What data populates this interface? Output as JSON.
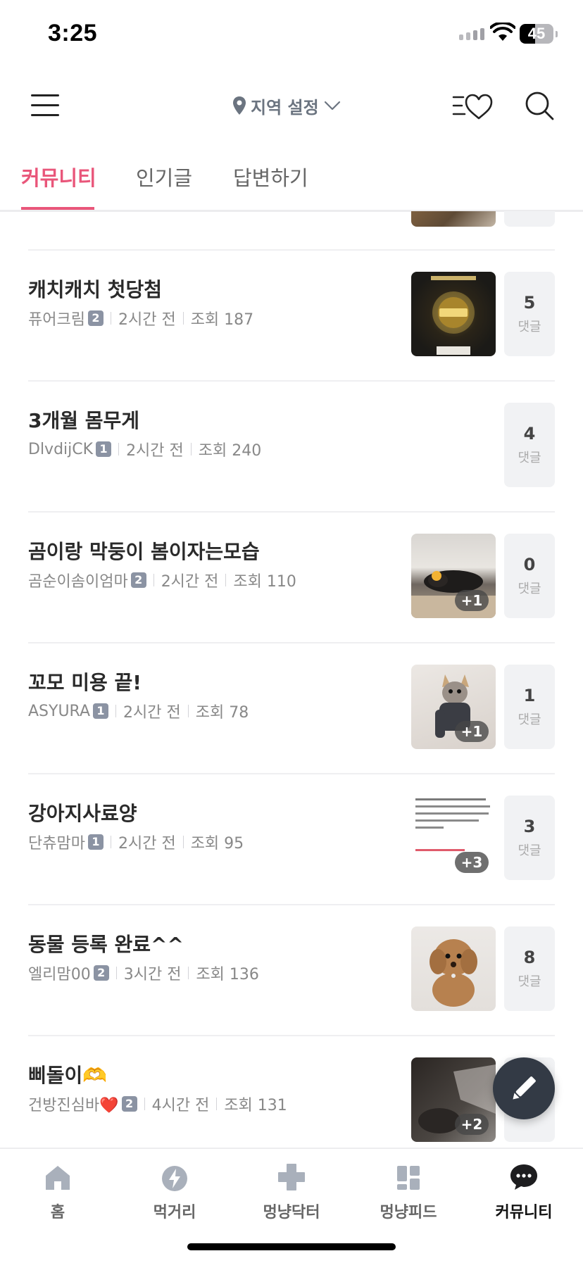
{
  "status_bar": {
    "time": "3:25",
    "battery": "45"
  },
  "header": {
    "region_label": "지역 설정"
  },
  "tabs": [
    {
      "label": "커뮤니티",
      "active": true
    },
    {
      "label": "인기글",
      "active": false
    },
    {
      "label": "답변하기",
      "active": false
    }
  ],
  "posts": [
    {
      "title": "캐치캐치 첫당첨",
      "author": "퓨어크림",
      "level": "2",
      "time": "2시간 전",
      "views": "조회 187",
      "comments": "5",
      "comments_label": "댓글",
      "thumb": "gold-bar",
      "extra_images": ""
    },
    {
      "title": "3개월 몸무게",
      "author": "DlvdijCK",
      "level": "1",
      "time": "2시간 전",
      "views": "조회 240",
      "comments": "4",
      "comments_label": "댓글",
      "thumb": "",
      "extra_images": ""
    },
    {
      "title": "곰이랑 막둥이 봄이자는모습",
      "author": "곰순이솜이엄마",
      "level": "2",
      "time": "2시간 전",
      "views": "조회 110",
      "comments": "0",
      "comments_label": "댓글",
      "thumb": "sleeping-pets",
      "extra_images": "+1"
    },
    {
      "title": "꼬모 미용 끝!",
      "author": "ASYURA",
      "level": "1",
      "time": "2시간 전",
      "views": "조회 78",
      "comments": "1",
      "comments_label": "댓글",
      "thumb": "yorkie",
      "extra_images": "+1"
    },
    {
      "title": "강아지사료양",
      "author": "단츄맘마",
      "level": "1",
      "time": "2시간 전",
      "views": "조회 95",
      "comments": "3",
      "comments_label": "댓글",
      "thumb": "text-doc",
      "extra_images": "+3"
    },
    {
      "title": "동물 등록 완료^^",
      "author": "엘리맘00",
      "level": "2",
      "time": "3시간 전",
      "views": "조회 136",
      "comments": "8",
      "comments_label": "댓글",
      "thumb": "poodle",
      "extra_images": ""
    },
    {
      "title": "삐돌이🫶",
      "author": "건방진심바❤️",
      "level": "2",
      "time": "4시간 전",
      "views": "조회 131",
      "comments": "",
      "comments_label": "",
      "thumb": "dark-photo",
      "extra_images": "+2"
    }
  ],
  "bottom_nav": [
    {
      "label": "홈",
      "icon": "home-icon",
      "active": false
    },
    {
      "label": "먹거리",
      "icon": "food-icon",
      "active": false
    },
    {
      "label": "멍냥닥터",
      "icon": "medical-cross-icon",
      "active": false
    },
    {
      "label": "멍냥피드",
      "icon": "feed-icon",
      "active": false
    },
    {
      "label": "커뮤니티",
      "icon": "chat-bubble-icon",
      "active": true
    }
  ],
  "colors": {
    "accent": "#e9567a",
    "badge": "#8b93a3",
    "fab": "#333a45"
  }
}
